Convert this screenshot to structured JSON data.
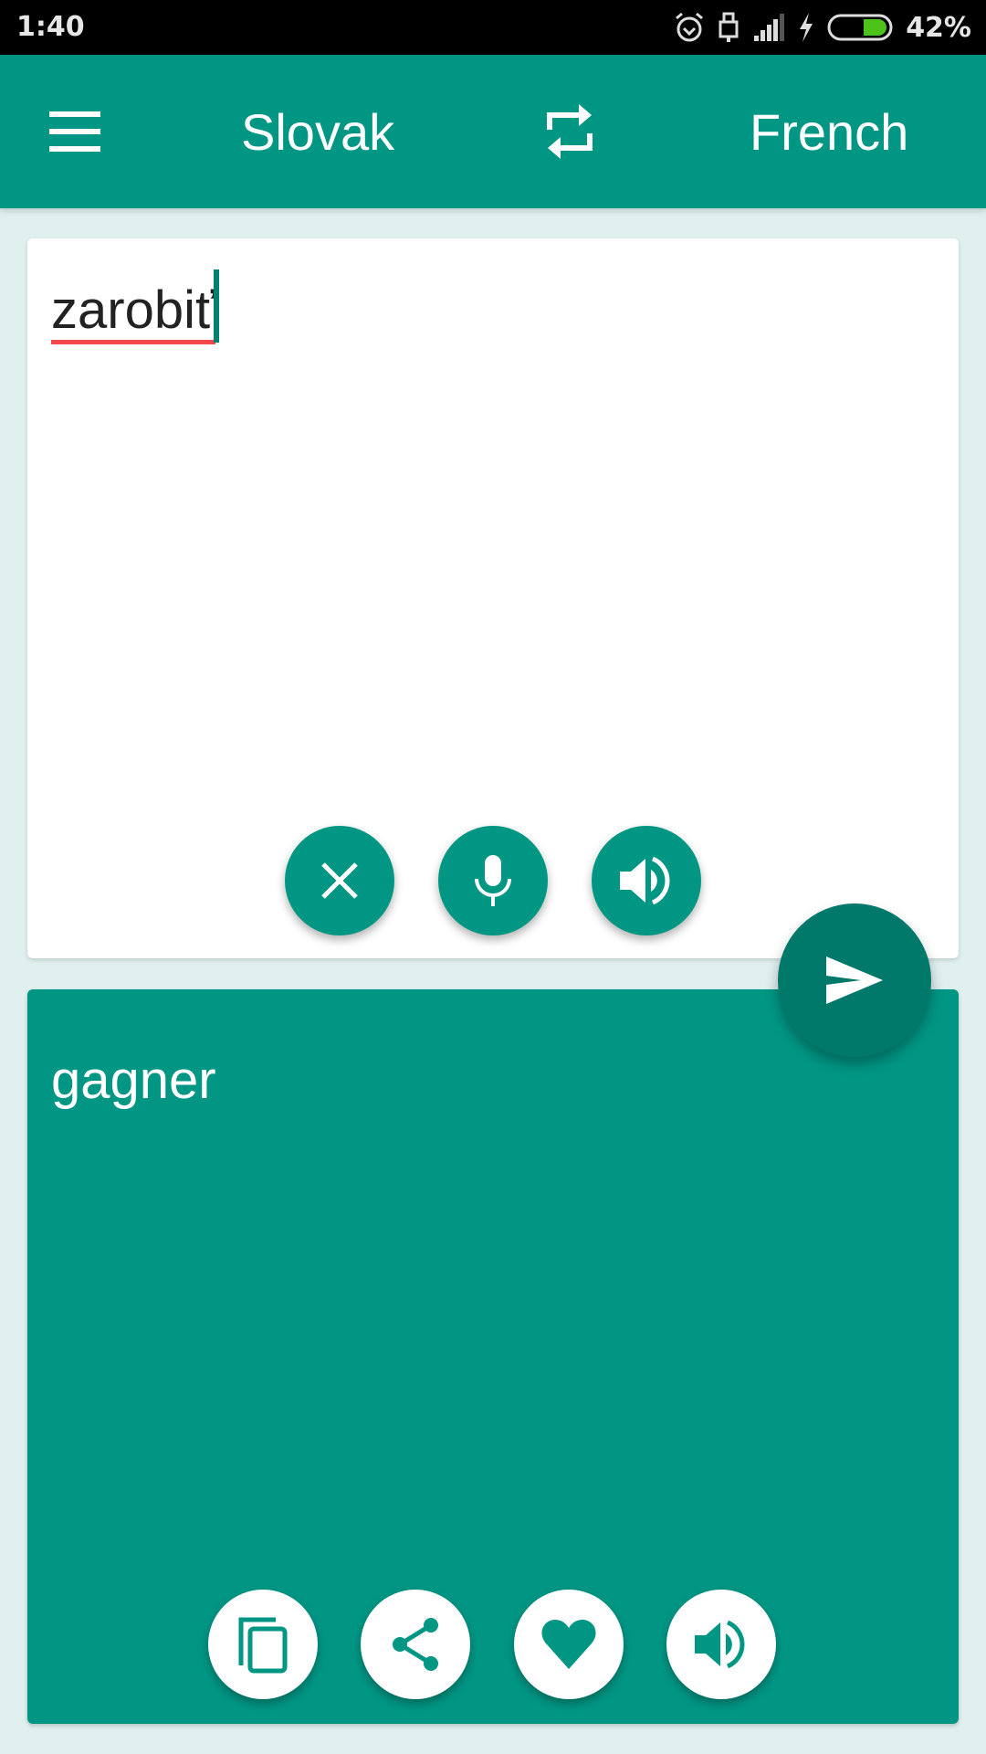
{
  "status_bar": {
    "time": "1:40",
    "battery_percent": "42%",
    "battery_level": 0.42,
    "icons": [
      "alarm-icon",
      "usb-lock-icon",
      "signal-icon",
      "charging-icon",
      "battery-icon"
    ]
  },
  "app_bar": {
    "menu_icon": "hamburger-menu-icon",
    "source_language": "Slovak",
    "swap_icon": "swap-languages-icon",
    "target_language": "French"
  },
  "input": {
    "text": "zarobiť",
    "actions": [
      {
        "name": "clear",
        "icon": "close-icon"
      },
      {
        "name": "voice-input",
        "icon": "microphone-icon"
      },
      {
        "name": "speak-input",
        "icon": "speaker-icon"
      }
    ]
  },
  "translate_button": {
    "icon": "send-icon"
  },
  "output": {
    "text": "gagner",
    "actions": [
      {
        "name": "copy",
        "icon": "copy-icon"
      },
      {
        "name": "share",
        "icon": "share-icon"
      },
      {
        "name": "favorite",
        "icon": "heart-icon"
      },
      {
        "name": "speak-output",
        "icon": "speaker-icon"
      }
    ]
  },
  "colors": {
    "primary": "#009684",
    "primary_dark": "#00796b",
    "background": "#dff0ee",
    "spellcheck_underline": "#f0484d",
    "battery_fill": "#4cc21a"
  }
}
